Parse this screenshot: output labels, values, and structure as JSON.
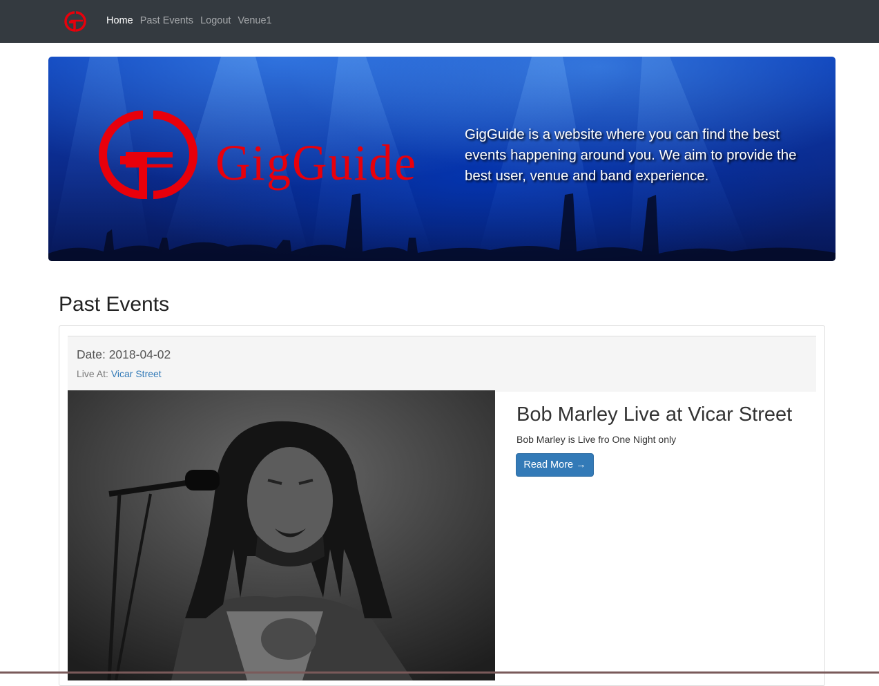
{
  "navbar": {
    "logo_icon": "gigguide-gg-logo-icon",
    "links": [
      {
        "label": "Home",
        "active": true
      },
      {
        "label": "Past Events",
        "active": false
      },
      {
        "label": "Logout",
        "active": false
      },
      {
        "label": "Venue1",
        "active": false
      }
    ]
  },
  "hero": {
    "logo_text": "GigGuide",
    "tagline": "GigGuide is a website where you can find the best events happening around you. We aim to provide the best user, venue and band experience.",
    "brand_color": "#e8000b"
  },
  "past_events": {
    "title": "Past Events",
    "events": [
      {
        "date_label": "Date: 2018-04-02",
        "live_at_label": "Live At:",
        "venue": "Vicar Street",
        "title": "Bob Marley Live at Vicar Street",
        "description": "Bob Marley is Live fro One Night only",
        "read_more_label": "Read More →",
        "photo_icon": "singer-photo-icon"
      }
    ]
  },
  "colors": {
    "navbar_bg": "#343a40",
    "link_blue": "#337ab7",
    "button_blue": "#337ab7"
  }
}
